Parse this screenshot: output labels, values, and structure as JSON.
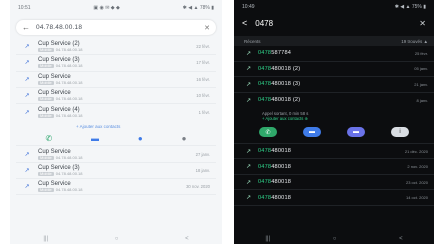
{
  "light": {
    "status_time": "10:51",
    "status_icons": "▣ ◉ ✉ ◆ ◆",
    "status_right": "✱ ◀ ▲ 78% ▮",
    "search_value": "04.78.48.00.18",
    "calls": [
      {
        "title": "Cup Service (2)",
        "sub": "04.78.48.00.18",
        "date": "22 févr."
      },
      {
        "title": "Cup Service (3)",
        "sub": "04.78.48.00.18",
        "date": "17 févr."
      },
      {
        "title": "Cup Service",
        "sub": "04.78.48.00.18",
        "date": "16 févr."
      },
      {
        "title": "Cup Service",
        "sub": "04.78.48.00.18",
        "date": "10 févr."
      },
      {
        "title": "Cup Service (4)",
        "sub": "04.78.48.00.18",
        "date": "1 févr."
      }
    ],
    "add_contact": "+ Ajouter aux contacts",
    "calls_after": [
      {
        "title": "Cup Service",
        "sub": "04.78.48.00.18",
        "date": "27 janv."
      },
      {
        "title": "Cup Service (3)",
        "sub": "04.78.48.00.18",
        "date": "18 janv."
      },
      {
        "title": "Cup Service",
        "sub": "04.78.48.00.18",
        "date": "30 nov. 2020"
      }
    ],
    "tag_label": "Mobile",
    "nav": [
      "|||",
      "○",
      "<"
    ]
  },
  "dark": {
    "status_time": "10:49",
    "status_right": "✱ ◀ ▲ 75% ▮",
    "search_value": "0478",
    "section_left": "Récents",
    "section_right": "19 trouvés ▲",
    "rows_top": [
      {
        "hl": "0478",
        "rest": "587784",
        "date": "25 févr."
      },
      {
        "hl": "0478",
        "rest": "480018 (2)",
        "date": "05 janv."
      },
      {
        "hl": "0478",
        "rest": "480018 (3)",
        "date": "21 janv."
      },
      {
        "hl": "0478",
        "rest": "480018 (2)",
        "date": "8 janv."
      }
    ],
    "detail_line1": "Appel sortant, 0 min 58 s",
    "detail_line2": "+ Ajouter aux contacts ⊕",
    "rows_bottom": [
      {
        "hl": "0478",
        "rest": "480018",
        "date": "21 déc. 2020"
      },
      {
        "hl": "0478",
        "rest": "480018",
        "date": "2 nov. 2020"
      },
      {
        "hl": "0478",
        "rest": "480018",
        "date": "23 oct. 2020"
      },
      {
        "hl": "0478",
        "rest": "480018",
        "date": "14 oct. 2020"
      }
    ],
    "nav": [
      "|||",
      "○",
      "<"
    ]
  }
}
